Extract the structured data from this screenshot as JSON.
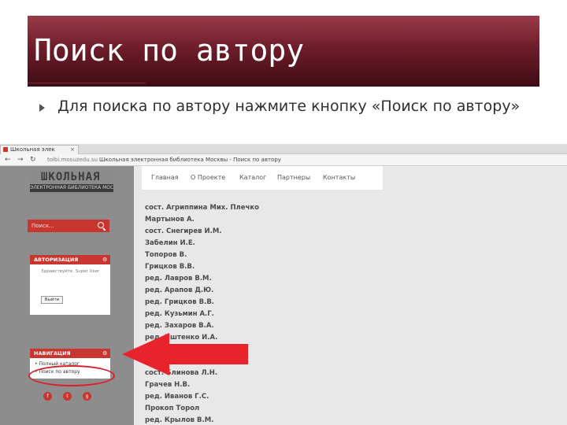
{
  "slide": {
    "title": "Поиск по автору",
    "bullet": "Для поиска по автору нажмите кнопку «Поиск по автору»"
  },
  "browser": {
    "tab_label": "Школьная элек",
    "tab_close": "×",
    "url_host": "tolbi.mosuzedu.su",
    "page_title": "Школьная электронная библиотека Москвы - Поиск по автору"
  },
  "site": {
    "logo_text": "ШКОЛЬНАЯ",
    "logo_subtitle": "ЭЛЕКТРОННАЯ БИБЛИОТЕКА МОСКВЫ",
    "search_placeholder": "Поиск...",
    "auth_title": "АВТОРИЗАЦИЯ",
    "auth_greeting": "Здравствуйте, Super User",
    "logout_label": "Выйти",
    "nav_title": "НАВИГАЦИЯ",
    "nav_items": [
      "Полный каталог",
      "Поиск по автору"
    ],
    "menu": [
      "Главная",
      "О Проекте",
      "Каталог",
      "Партнеры",
      "Контакты"
    ],
    "authors": [
      "сост. Агриппина Мих. Плечко",
      "Мартынов А.",
      "сост. Снегирев И.М.",
      "Забелин И.Е.",
      "Топоров В.",
      "Грицков В.В.",
      "ред. Лавров В.М.",
      "ред. Арапов Д.Ю.",
      "ред. Грицков В.В.",
      "ред. Кузьмин А.Г.",
      "ред. Захаров В.А.",
      "ред. Иштенко И.А.",
      "сост. Блинова Л.Н.",
      "Грачев Н.В.",
      "ред. Иванов Г.С.",
      "Прокоп Торол",
      "ред. Крылов В.М."
    ]
  },
  "colors": {
    "accent": "#c9352f",
    "header_dark": "#3f0c15",
    "arrow": "#e8232b"
  }
}
